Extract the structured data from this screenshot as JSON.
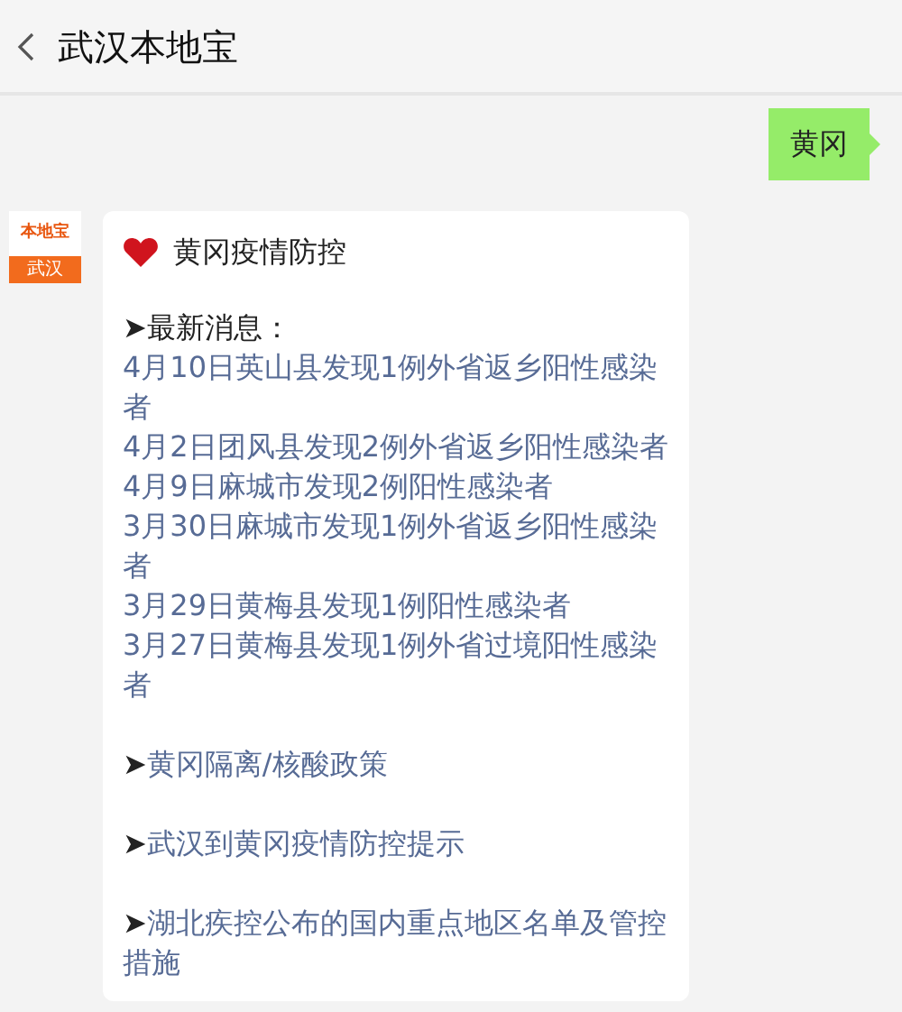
{
  "header": {
    "title": "武汉本地宝"
  },
  "messages": [
    {
      "kind": "sent",
      "text": "黄冈"
    },
    {
      "kind": "card",
      "avatar": {
        "brand": "本地宝",
        "city": "武汉"
      },
      "title": "黄冈疫情防控",
      "items": [
        {
          "kind": "heading",
          "marker": "➤",
          "text": "最新消息："
        },
        {
          "kind": "news",
          "text": "4月10日英山县发现1例外省返乡阳性感染者"
        },
        {
          "kind": "news",
          "text": "4月2日团风县发现2例外省返乡阳性感染者"
        },
        {
          "kind": "news",
          "text": "4月9日麻城市发现2例阳性感染者"
        },
        {
          "kind": "news",
          "text": "3月30日麻城市发现1例外省返乡阳性感染者"
        },
        {
          "kind": "news",
          "text": "3月29日黄梅县发现1例阳性感染者"
        },
        {
          "kind": "news",
          "text": "3月27日黄梅县发现1例外省过境阳性感染者"
        },
        {
          "kind": "link",
          "marker": "➤",
          "text": "黄冈隔离/核酸政策"
        },
        {
          "kind": "link",
          "marker": "➤",
          "text": "武汉到黄冈疫情防控提示"
        },
        {
          "kind": "link",
          "marker": "➤",
          "text": "湖北疾控公布的国内重点地区名单及管控措施"
        }
      ]
    }
  ]
}
